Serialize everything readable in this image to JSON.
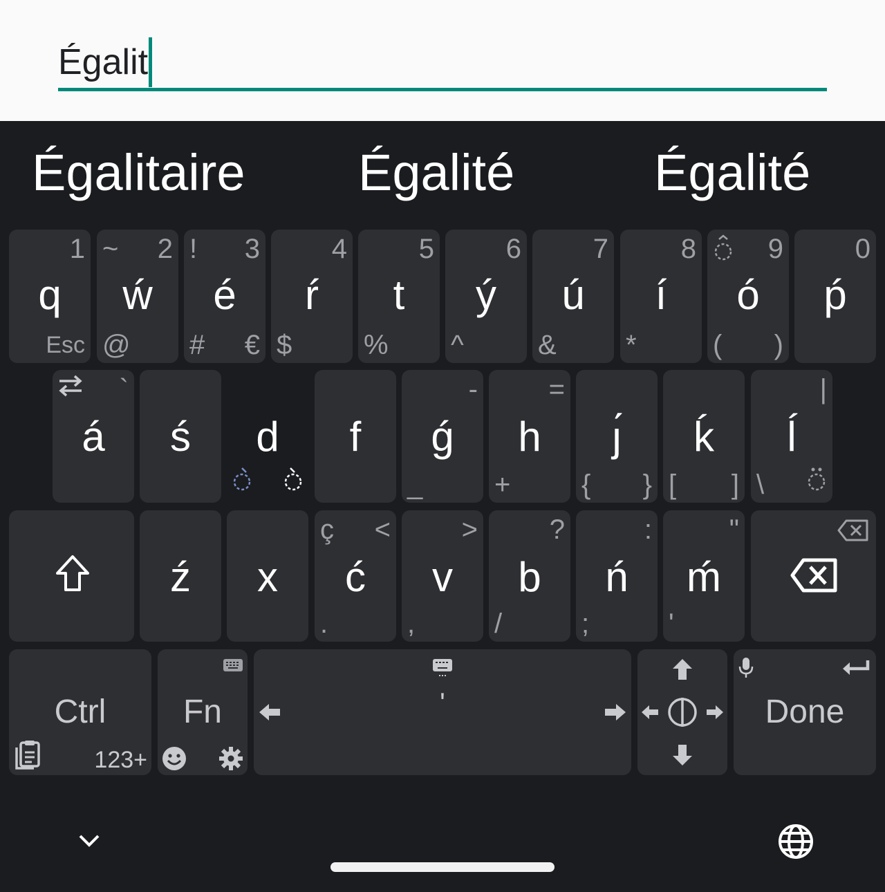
{
  "input": {
    "value": "Égalit"
  },
  "suggestions": [
    "Égalitaire",
    "Égalité",
    "Égalité"
  ],
  "row1": [
    {
      "main": "q",
      "tr": "1",
      "tl": "",
      "bl": "",
      "br": "Esc"
    },
    {
      "main": "ẃ",
      "tr": "2",
      "tl": "~",
      "bl": "@",
      "br": ""
    },
    {
      "main": "é",
      "tr": "3",
      "tl": "!",
      "bl": "#",
      "br": "€"
    },
    {
      "main": "ŕ",
      "tr": "4",
      "tl": "",
      "bl": "$",
      "br": ""
    },
    {
      "main": "t",
      "tr": "5",
      "tl": "",
      "bl": "%",
      "br": ""
    },
    {
      "main": "ý",
      "tr": "6",
      "tl": "",
      "bl": "^",
      "br": ""
    },
    {
      "main": "ú",
      "tr": "7",
      "tl": "",
      "bl": "&",
      "br": ""
    },
    {
      "main": "í",
      "tr": "8",
      "tl": "",
      "bl": "*",
      "br": ""
    },
    {
      "main": "ó",
      "tr": "9",
      "tl": "",
      "bl": "(",
      "br": ")"
    },
    {
      "main": "ṕ",
      "tr": "0",
      "tl": "",
      "bl": "",
      "br": ""
    }
  ],
  "row2": [
    {
      "main": "á",
      "tr": "`",
      "tl": "",
      "bl": "",
      "br": ""
    },
    {
      "main": "ś",
      "tr": "",
      "tl": "",
      "bl": "",
      "br": ""
    },
    {
      "main": "d",
      "tr": "",
      "tl": "",
      "bl": "",
      "br": ""
    },
    {
      "main": "f",
      "tr": "",
      "tl": "",
      "bl": "",
      "br": ""
    },
    {
      "main": "ǵ",
      "tr": "-",
      "tl": "",
      "bl": "_",
      "br": ""
    },
    {
      "main": "h",
      "tr": "=",
      "tl": "",
      "bl": "+",
      "br": ""
    },
    {
      "main": "ȷ́",
      "tr": "",
      "tl": "",
      "bl": "{",
      "br": "}"
    },
    {
      "main": "ḱ",
      "tr": "",
      "tl": "",
      "bl": "[",
      "br": "]"
    },
    {
      "main": "ĺ",
      "tr": "|",
      "tl": "",
      "bl": "\\",
      "br": ""
    }
  ],
  "row3": [
    {
      "main": "ź",
      "tr": "",
      "tl": "",
      "bl": "",
      "br": ""
    },
    {
      "main": "x",
      "tr": "",
      "tl": "",
      "bl": "",
      "br": ""
    },
    {
      "main": "ć",
      "tr": "<",
      "tl": "ç",
      "bl": ".",
      "br": ""
    },
    {
      "main": "v",
      "tr": ">",
      "tl": "",
      "bl": ",",
      "br": ""
    },
    {
      "main": "b",
      "tr": "?",
      "tl": "",
      "bl": "/",
      "br": ""
    },
    {
      "main": "ń",
      "tr": ":",
      "tl": "",
      "bl": ";",
      "br": ""
    },
    {
      "main": "ḿ",
      "tr": "\"",
      "tl": "",
      "bl": "'",
      "br": ""
    }
  ],
  "bottom": {
    "ctrl": "Ctrl",
    "ctrl_hint": "123+",
    "fn": "Fn",
    "space_hint": "'",
    "done": "Done"
  },
  "icons": {
    "shift": "shift-icon",
    "backspace": "backspace-icon",
    "clipboard": "clipboard-icon",
    "emoji": "emoji-icon",
    "settings": "gear-icon",
    "keyboard": "keyboard-icon",
    "mic": "microphone-icon",
    "enter": "enter-icon",
    "globe": "globe-icon",
    "hide": "chevron-down-icon"
  },
  "colors": {
    "accent": "#00897b",
    "keyboard_bg": "#1b1c20",
    "key_bg": "#2e2f33",
    "hint": "#9ea0a5"
  }
}
